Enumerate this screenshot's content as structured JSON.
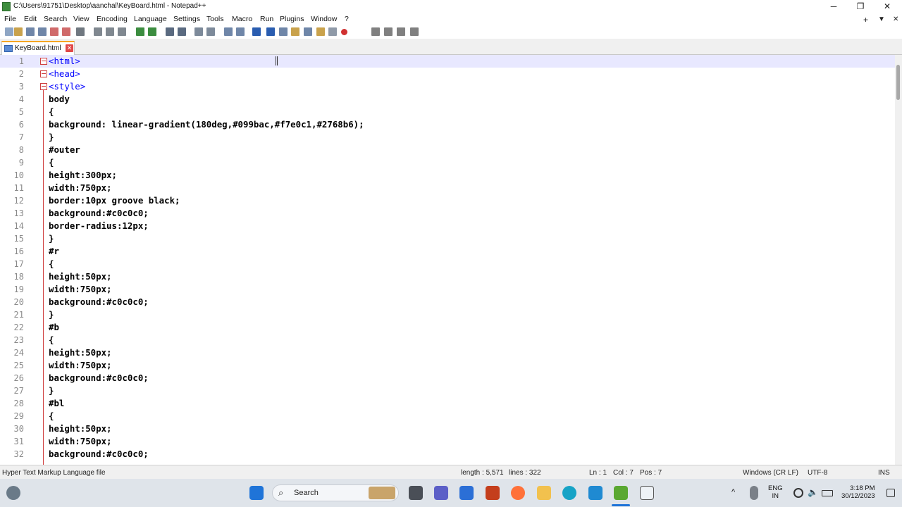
{
  "window": {
    "title": "C:\\Users\\91751\\Desktop\\aanchal\\KeyBoard.html - Notepad++",
    "minimize_glyph": "─",
    "maximize_glyph": "❐",
    "close_glyph": "✕"
  },
  "menu": {
    "items": [
      "File",
      "Edit",
      "Search",
      "View",
      "Encoding",
      "Language",
      "Settings",
      "Tools",
      "Macro",
      "Run",
      "Plugins",
      "Window",
      "?"
    ],
    "right_glyphs": [
      "+",
      "▼",
      "✕"
    ]
  },
  "toolbar": {
    "icons": [
      "new-file-icon",
      "open-file-icon",
      "save-icon",
      "save-all-icon",
      "close-icon",
      "close-all-icon",
      "print-icon",
      "cut-icon",
      "copy-icon",
      "paste-icon",
      "undo-icon",
      "redo-icon",
      "find-icon",
      "replace-icon",
      "zoom-in-icon",
      "zoom-out-icon",
      "sync-vertical-icon",
      "sync-horizontal-icon",
      "word-wrap-icon",
      "show-all-characters-icon",
      "indent-guide-icon",
      "document-map-icon",
      "function-list-icon",
      "folder-workspace-icon",
      "monitoring-icon",
      "record-macro-icon",
      "stop-macro-icon",
      "play-macro-icon",
      "run-macro-multiple-icon",
      "save-macro-icon"
    ],
    "accent": "#2a5db0"
  },
  "tab": {
    "label": "KeyBoard.html",
    "close_glyph": "✕"
  },
  "editor": {
    "lines": [
      {
        "n": "1",
        "text": "<html>",
        "kind": "tag",
        "fold": true
      },
      {
        "n": "2",
        "text": "<head>",
        "kind": "tag",
        "fold": true
      },
      {
        "n": "3",
        "text": "<style>",
        "kind": "tag",
        "fold": true
      },
      {
        "n": "4",
        "text": "body",
        "kind": "css"
      },
      {
        "n": "5",
        "text": "{",
        "kind": "css"
      },
      {
        "n": "6",
        "text": "background: linear-gradient(180deg,#099bac,#f7e0c1,#2768b6);",
        "kind": "css"
      },
      {
        "n": "7",
        "text": "}",
        "kind": "css"
      },
      {
        "n": "8",
        "text": "#outer",
        "kind": "css"
      },
      {
        "n": "9",
        "text": "{",
        "kind": "css"
      },
      {
        "n": "10",
        "text": "height:300px;",
        "kind": "css"
      },
      {
        "n": "11",
        "text": "width:750px;",
        "kind": "css"
      },
      {
        "n": "12",
        "text": "border:10px groove black;",
        "kind": "css"
      },
      {
        "n": "13",
        "text": "background:#c0c0c0;",
        "kind": "css"
      },
      {
        "n": "14",
        "text": "border-radius:12px;",
        "kind": "css"
      },
      {
        "n": "15",
        "text": "}",
        "kind": "css"
      },
      {
        "n": "16",
        "text": "#r",
        "kind": "css"
      },
      {
        "n": "17",
        "text": "{",
        "kind": "css"
      },
      {
        "n": "18",
        "text": "height:50px;",
        "kind": "css"
      },
      {
        "n": "19",
        "text": "width:750px;",
        "kind": "css"
      },
      {
        "n": "20",
        "text": "background:#c0c0c0;",
        "kind": "css"
      },
      {
        "n": "21",
        "text": "}",
        "kind": "css"
      },
      {
        "n": "22",
        "text": "#b",
        "kind": "css"
      },
      {
        "n": "23",
        "text": "{",
        "kind": "css"
      },
      {
        "n": "24",
        "text": "height:50px;",
        "kind": "css"
      },
      {
        "n": "25",
        "text": "width:750px;",
        "kind": "css"
      },
      {
        "n": "26",
        "text": "background:#c0c0c0;",
        "kind": "css"
      },
      {
        "n": "27",
        "text": "}",
        "kind": "css"
      },
      {
        "n": "28",
        "text": "#bl",
        "kind": "css"
      },
      {
        "n": "29",
        "text": "{",
        "kind": "css"
      },
      {
        "n": "30",
        "text": "height:50px;",
        "kind": "css"
      },
      {
        "n": "31",
        "text": "width:750px;",
        "kind": "css"
      },
      {
        "n": "32",
        "text": "background:#c0c0c0;",
        "kind": "css"
      }
    ],
    "current_line": "1",
    "tag_color": "#0000ff",
    "current_line_color": "#e8e8ff"
  },
  "status": {
    "file_type": "Hyper Text Markup Language file",
    "length": "length : 5,571",
    "lines": "lines : 322",
    "ln": "Ln : 1",
    "col": "Col : 7",
    "pos": "Pos : 7",
    "eol": "Windows (CR LF)",
    "encoding": "UTF-8",
    "mode": "INS"
  },
  "taskbar": {
    "search_label": "Search",
    "lang_top": "ENG",
    "lang_bottom": "IN",
    "time": "3:18 PM",
    "date": "30/12/2023",
    "apps": [
      "start-icon",
      "widgets-icon",
      "task-view-icon",
      "teams-icon",
      "store-icon",
      "office-icon",
      "firefox-icon",
      "file-explorer-icon",
      "edge-icon",
      "vscode-icon",
      "notepadpp-icon",
      "snipping-tool-icon"
    ],
    "tray": [
      "chevron-up-icon",
      "microphone-icon",
      "network-icon",
      "volume-muted-icon",
      "battery-icon"
    ]
  }
}
